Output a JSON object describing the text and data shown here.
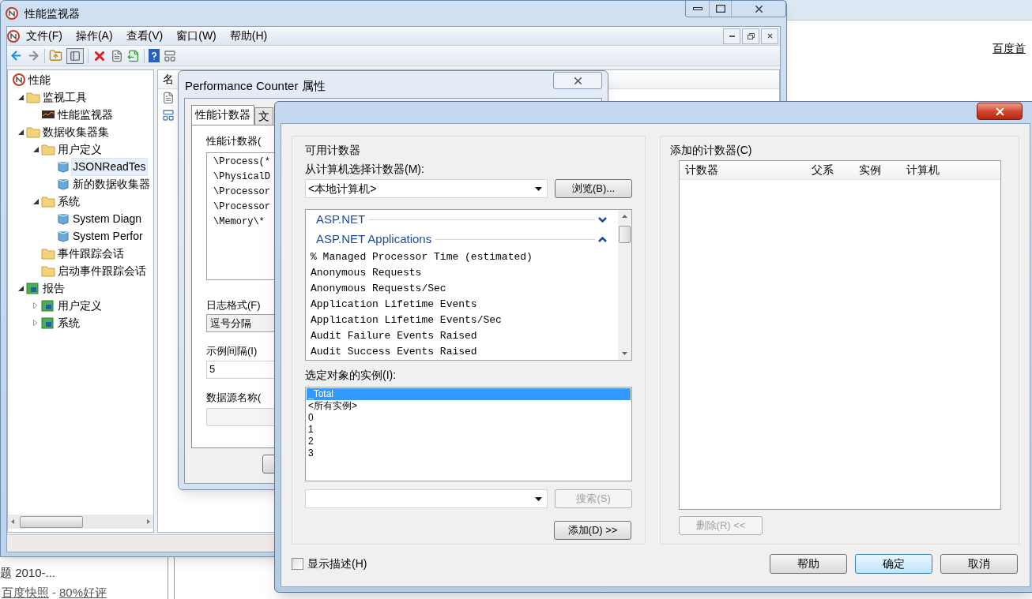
{
  "background_page": {
    "top_link": "百度首",
    "result_title": "题 2010-...",
    "result_links": [
      "百度快照",
      "80%好评"
    ],
    "result_separator": "-"
  },
  "main_window": {
    "title": "性能监视器",
    "menu": [
      "文件(F)",
      "操作(A)",
      "查看(V)",
      "窗口(W)",
      "帮助(H)"
    ],
    "tree": [
      {
        "label": "性能",
        "kind": "gauge",
        "selected": false,
        "children": [
          {
            "label": "监视工具",
            "kind": "folder",
            "selected": false,
            "expanded": true,
            "children": [
              {
                "label": "性能监视器",
                "kind": "monitor",
                "selected": false
              }
            ]
          },
          {
            "label": "数据收集器集",
            "kind": "folder",
            "selected": false,
            "expanded": true,
            "children": [
              {
                "label": "用户定义",
                "kind": "folder",
                "selected": false,
                "expanded": true,
                "children": [
                  {
                    "label": "JSONReadTes",
                    "kind": "dataset",
                    "selected": true
                  },
                  {
                    "label": "新的数据收集器",
                    "kind": "dataset",
                    "selected": false
                  }
                ]
              },
              {
                "label": "系统",
                "kind": "folder",
                "selected": false,
                "expanded": true,
                "children": [
                  {
                    "label": "System Diagn",
                    "kind": "dataset",
                    "selected": false
                  },
                  {
                    "label": "System Perfor",
                    "kind": "dataset",
                    "selected": false
                  }
                ]
              },
              {
                "label": "事件跟踪会话",
                "kind": "folder",
                "selected": false
              },
              {
                "label": "启动事件跟踪会话",
                "kind": "folder",
                "selected": false
              }
            ]
          },
          {
            "label": "报告",
            "kind": "report",
            "selected": false,
            "expanded": true,
            "children": [
              {
                "label": "用户定义",
                "kind": "report",
                "selected": false,
                "expanded": false
              },
              {
                "label": "系统",
                "kind": "report",
                "selected": false,
                "expanded": false
              }
            ]
          }
        ]
      }
    ],
    "list_header": "名"
  },
  "properties_dialog": {
    "title": "Performance Counter 属性",
    "tabs": [
      {
        "label": "性能计数器",
        "selected": true
      },
      {
        "label": "文",
        "selected": false
      }
    ],
    "counters_label": "性能计数器(",
    "counters": [
      "\\Process(*",
      "\\PhysicalD",
      "\\Processor",
      "\\Processor",
      "\\Memory\\*"
    ],
    "log_format_label": "日志格式(F)",
    "log_format": "逗号分隔",
    "interval_label": "示例间隔(I)",
    "interval": "5",
    "dsn_label": "数据源名称("
  },
  "add_counters_dialog": {
    "available_label": "可用计数器",
    "computer_label": "从计算机选择计数器(M):",
    "computer": "<本地计算机>",
    "browse_button": "浏览(B)...",
    "counter_groups": [
      {
        "name": "ASP.NET",
        "expanded": false
      },
      {
        "name": "ASP.NET Applications",
        "expanded": true,
        "counters": [
          "% Managed Processor Time (estimated)",
          "Anonymous Requests",
          "Anonymous Requests/Sec",
          "Application Lifetime Events",
          "Application Lifetime Events/Sec",
          "Audit Failure Events Raised",
          "Audit Success Events Raised"
        ]
      }
    ],
    "instances_label": "选定对象的实例(I):",
    "instances": [
      {
        "label": "_Total",
        "selected": true
      },
      {
        "label": "<所有实例>",
        "selected": false
      },
      {
        "label": "0",
        "selected": false
      },
      {
        "label": "1",
        "selected": false
      },
      {
        "label": "2",
        "selected": false
      },
      {
        "label": "3",
        "selected": false
      }
    ],
    "search_button": {
      "label": "搜索(S)",
      "disabled": true
    },
    "add_button": {
      "label": "添加(D) >>",
      "disabled": false
    },
    "added_label": "添加的计数器(C)",
    "added_columns": [
      "计数器",
      "父系",
      "实例",
      "计算机"
    ],
    "remove_button": {
      "label": "删除(R) <<",
      "disabled": true
    },
    "show_description": {
      "label": "显示描述(H)",
      "checked": false
    },
    "buttons": [
      {
        "label": "帮助",
        "default": false
      },
      {
        "label": "确定",
        "default": true
      },
      {
        "label": "取消",
        "default": false
      }
    ]
  }
}
